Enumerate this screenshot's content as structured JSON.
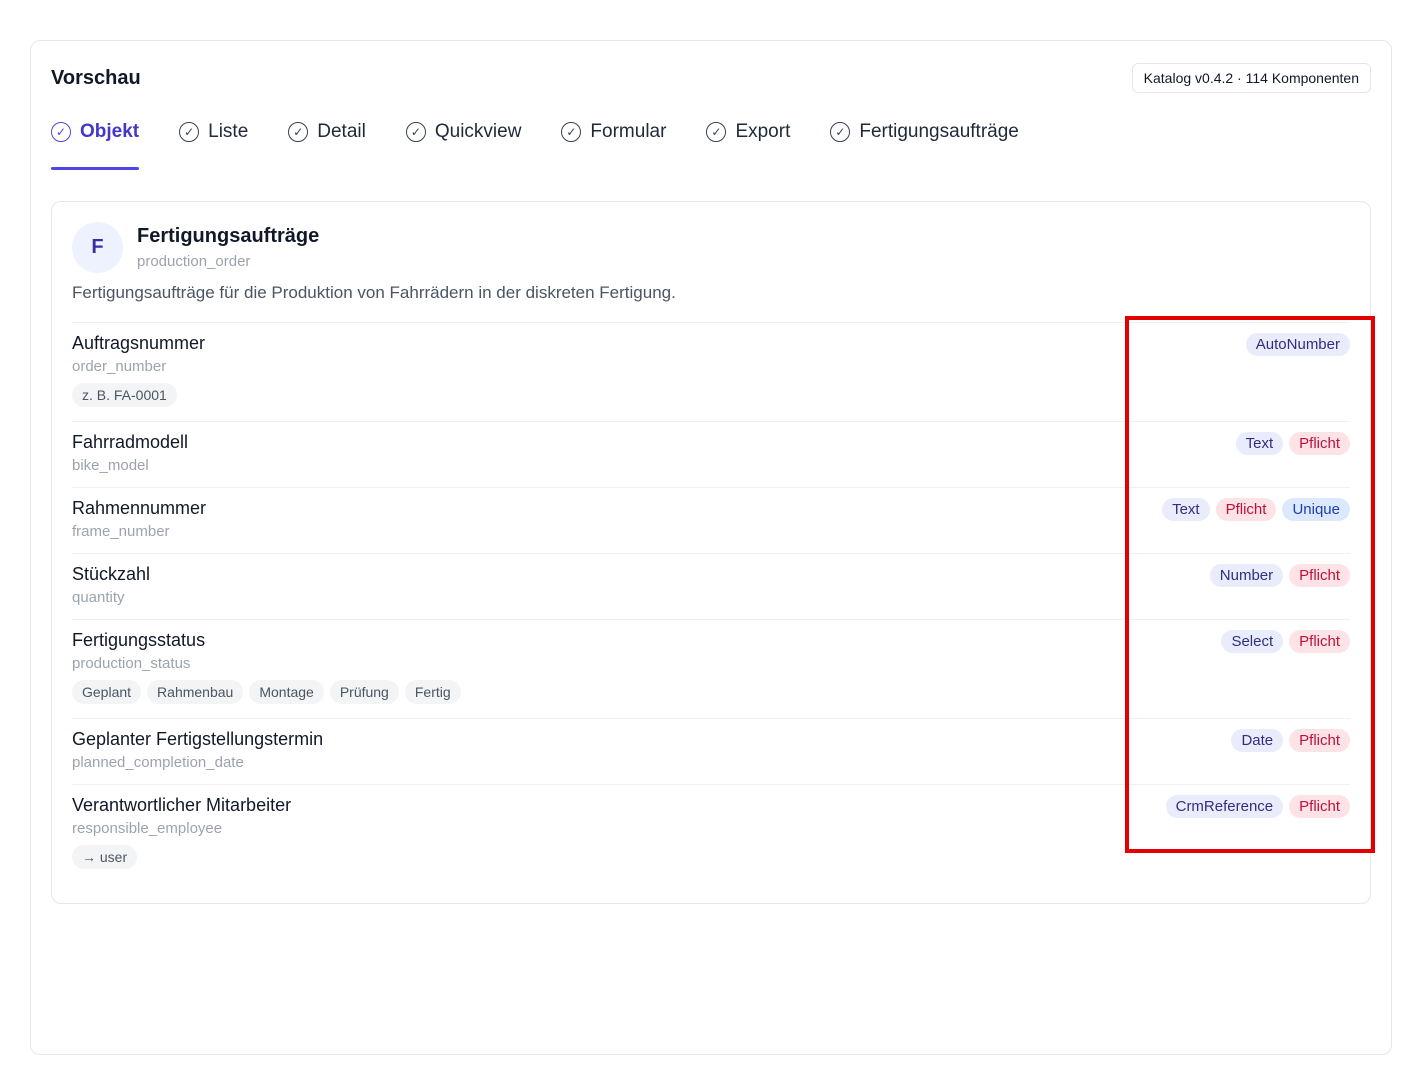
{
  "panel": {
    "title": "Vorschau",
    "catalog": "Katalog v0.4.2 · 114 Komponenten"
  },
  "tabs": [
    {
      "label": "Objekt",
      "icon": "check-circle-icon",
      "active": true
    },
    {
      "label": "Liste",
      "icon": "check-circle-icon"
    },
    {
      "label": "Detail",
      "icon": "check-circle-icon"
    },
    {
      "label": "Quickview",
      "icon": "check-circle-icon"
    },
    {
      "label": "Formular",
      "icon": "check-circle-icon"
    },
    {
      "label": "Export",
      "icon": "check-circle-icon"
    },
    {
      "label": "Fertigungsaufträge",
      "icon": "check-circle-icon"
    }
  ],
  "object": {
    "avatar": "F",
    "title": "Fertigungsaufträge",
    "key": "production_order",
    "description": "Fertigungsaufträge für die Produktion von Fahrrädern in der diskreten Fertigung."
  },
  "fields": [
    {
      "label": "Auftragsnummer",
      "key": "order_number",
      "chips": [
        "z. B. FA-0001"
      ],
      "type": "AutoNumber",
      "required": false,
      "unique": false
    },
    {
      "label": "Fahrradmodell",
      "key": "bike_model",
      "chips": [],
      "type": "Text",
      "required": true,
      "unique": false
    },
    {
      "label": "Rahmennummer",
      "key": "frame_number",
      "chips": [],
      "type": "Text",
      "required": true,
      "unique": true
    },
    {
      "label": "Stückzahl",
      "key": "quantity",
      "chips": [],
      "type": "Number",
      "required": true,
      "unique": false
    },
    {
      "label": "Fertigungsstatus",
      "key": "production_status",
      "chips": [
        "Geplant",
        "Rahmenbau",
        "Montage",
        "Prüfung",
        "Fertig"
      ],
      "type": "Select",
      "required": true,
      "unique": false
    },
    {
      "label": "Geplanter Fertigstellungstermin",
      "key": "planned_completion_date",
      "chips": [],
      "type": "Date",
      "required": true,
      "unique": false
    },
    {
      "label": "Verantwortlicher Mitarbeiter",
      "key": "responsible_employee",
      "chips": [
        "→ user"
      ],
      "type": "CrmReference",
      "required": true,
      "unique": false
    }
  ],
  "labels": {
    "required": "Pflicht",
    "unique": "Unique"
  },
  "colors": {
    "accent": "#4f46e5",
    "highlight": "#e30000",
    "required_bg": "#fde2e6",
    "type_bg": "#e8ecfb"
  }
}
